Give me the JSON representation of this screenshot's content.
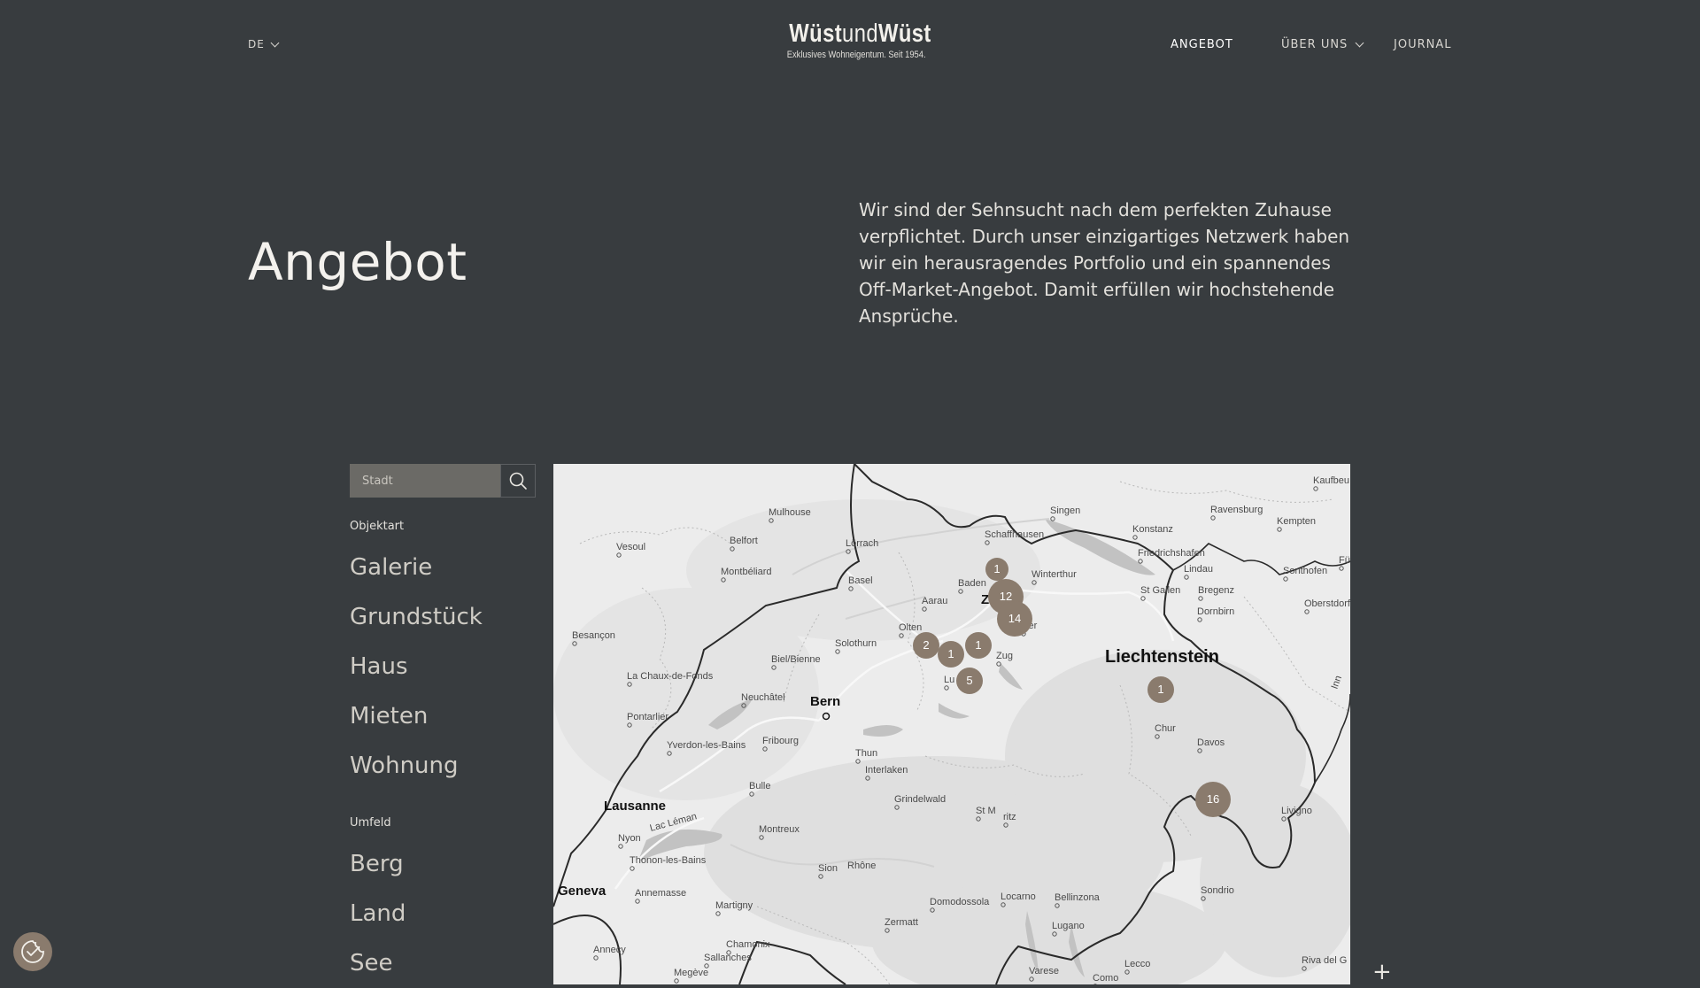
{
  "header": {
    "language": "DE",
    "logo_main_bold1": "Wüst",
    "logo_main_thin": "und",
    "logo_main_bold2": "Wüst",
    "logo_tagline": "Exklusives Wohneigentum. Seit 1954.",
    "nav": {
      "angebot": "ANGEBOT",
      "ueber_uns": "ÜBER UNS",
      "journal": "JOURNAL"
    }
  },
  "hero": {
    "title": "Angebot",
    "intro": "Wir sind der Sehnsucht nach dem perfekten Zuhause verpflichtet. Durch unser einzigartiges Netzwerk haben wir ein herausragendes Portfolio und ein spannendes Off-Market-Angebot. Damit erfüllen wir hochstehende Ansprüche."
  },
  "filters": {
    "search_placeholder": "Stadt",
    "objektart_label": "Objektart",
    "objektart": [
      "Galerie",
      "Grundstück",
      "Haus",
      "Mieten",
      "Wohnung"
    ],
    "umfeld_label": "Umfeld",
    "umfeld": [
      "Berg",
      "Land",
      "See"
    ]
  },
  "map": {
    "places": [
      {
        "name": "Mulhouse",
        "bold": false
      },
      {
        "name": "Belfort",
        "bold": false
      },
      {
        "name": "Lörrach",
        "bold": false
      },
      {
        "name": "Basel",
        "bold": false
      },
      {
        "name": "Vesoul",
        "bold": false
      },
      {
        "name": "Montbéliard",
        "bold": false
      },
      {
        "name": "Schaffhausen",
        "bold": false
      },
      {
        "name": "Singen",
        "bold": false
      },
      {
        "name": "Konstanz",
        "bold": false
      },
      {
        "name": "Ravensburg",
        "bold": false
      },
      {
        "name": "Kempten",
        "bold": false
      },
      {
        "name": "Kaufbeu",
        "bold": false
      },
      {
        "name": "Friedrichshafen",
        "bold": false
      },
      {
        "name": "Lindau",
        "bold": false
      },
      {
        "name": "Sonthofen",
        "bold": false
      },
      {
        "name": "Füs",
        "bold": false
      },
      {
        "name": "Winterthur",
        "bold": false
      },
      {
        "name": "Baden",
        "bold": false
      },
      {
        "name": "Aarau",
        "bold": false
      },
      {
        "name": "St Gallen",
        "bold": false
      },
      {
        "name": "Bregenz",
        "bold": false
      },
      {
        "name": "Oberstdorf",
        "bold": false
      },
      {
        "name": "Dornbirn",
        "bold": false
      },
      {
        "name": "Olten",
        "bold": false
      },
      {
        "name": "Solothurn",
        "bold": false
      },
      {
        "name": "Zug",
        "bold": false
      },
      {
        "name": "Besançon",
        "bold": false
      },
      {
        "name": "Biel/Bienne",
        "bold": false
      },
      {
        "name": "La Chaux-de-Fonds",
        "bold": false
      },
      {
        "name": "Neuchâtel",
        "bold": false
      },
      {
        "name": "Liechtenstein",
        "bold": true
      },
      {
        "name": "Bern",
        "bold": true
      },
      {
        "name": "Pontarlier",
        "bold": false
      },
      {
        "name": "Yverdon-les-Bains",
        "bold": false
      },
      {
        "name": "Fribourg",
        "bold": false
      },
      {
        "name": "Chur",
        "bold": false
      },
      {
        "name": "Thun",
        "bold": false
      },
      {
        "name": "Davos",
        "bold": false
      },
      {
        "name": "Interlaken",
        "bold": false
      },
      {
        "name": "Bulle",
        "bold": false
      },
      {
        "name": "Grindelwald",
        "bold": false
      },
      {
        "name": "Lausanne",
        "bold": true
      },
      {
        "name": "Montreux",
        "bold": false
      },
      {
        "name": "Livigno",
        "bold": false
      },
      {
        "name": "Nyon",
        "bold": false
      },
      {
        "name": "Thonon-les-Bains",
        "bold": false
      },
      {
        "name": "Lac Léman",
        "bold": false
      },
      {
        "name": "Sion",
        "bold": false
      },
      {
        "name": "Rhône",
        "bold": false
      },
      {
        "name": "Geneva",
        "bold": true
      },
      {
        "name": "Annemasse",
        "bold": false
      },
      {
        "name": "Sondrio",
        "bold": false
      },
      {
        "name": "Martigny",
        "bold": false
      },
      {
        "name": "Domodossola",
        "bold": false
      },
      {
        "name": "Locarno",
        "bold": false
      },
      {
        "name": "Bellinzona",
        "bold": false
      },
      {
        "name": "Zermatt",
        "bold": false
      },
      {
        "name": "Lugano",
        "bold": false
      },
      {
        "name": "Annecy",
        "bold": false
      },
      {
        "name": "Chamonix",
        "bold": false
      },
      {
        "name": "Sallanches",
        "bold": false
      },
      {
        "name": "Megève",
        "bold": false
      },
      {
        "name": "Varese",
        "bold": false
      },
      {
        "name": "Lecco",
        "bold": false
      },
      {
        "name": "Como",
        "bold": false
      },
      {
        "name": "Riva del G",
        "bold": false
      },
      {
        "name": "Inn",
        "bold": false
      },
      {
        "name": "Z",
        "bold": true
      },
      {
        "name": "ster",
        "bold": false
      },
      {
        "name": "Lu",
        "bold": false
      },
      {
        "name": "St M",
        "bold": false
      },
      {
        "name": "ritz",
        "bold": false
      }
    ],
    "clusters": [
      "1",
      "12",
      "14",
      "2",
      "1",
      "1",
      "5",
      "1",
      "16"
    ],
    "zoom_in": "+"
  },
  "colors": {
    "background": "#383c3f",
    "cluster": "#8a7b6d",
    "search_field": "#6b6a66"
  }
}
